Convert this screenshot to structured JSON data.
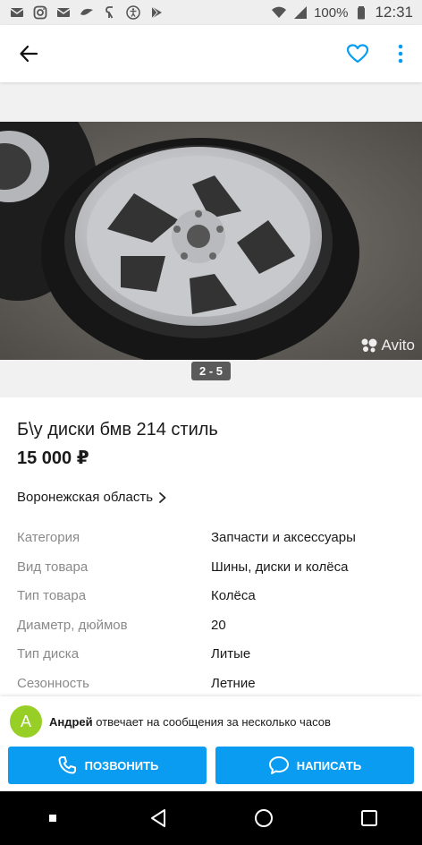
{
  "status_bar": {
    "battery": "100%",
    "time": "12:31",
    "icons": [
      "mail-icon",
      "instagram-icon",
      "mail-icon",
      "messenger-icon",
      "yandex-icon",
      "accessibility-icon",
      "play-store-icon",
      "wifi-icon",
      "signal-icon",
      "battery-icon"
    ]
  },
  "app_bar": {
    "back_icon": "arrow-back-icon",
    "favorite_icon": "heart-outline-icon",
    "more_icon": "more-vertical-icon"
  },
  "gallery": {
    "counter": "2 - 5",
    "watermark": "Avito"
  },
  "ad": {
    "title": "Б\\у диски бмв 214 стиль",
    "price": "15 000 ₽",
    "region": "Воронежская область"
  },
  "params": [
    {
      "name": "Категория",
      "value": "Запчасти и аксессуары"
    },
    {
      "name": "Вид товара",
      "value": "Шины, диски и колёса"
    },
    {
      "name": "Тип товара",
      "value": "Колёса"
    },
    {
      "name": "Диаметр, дюймов",
      "value": "20"
    },
    {
      "name": "Тип диска",
      "value": "Литые"
    },
    {
      "name": "Сезонность",
      "value": "Летние"
    }
  ],
  "contact": {
    "avatar_letter": "А",
    "seller_name": "Андрей",
    "seller_note": " отвечает на сообщения за несколько часов",
    "call_label": "ПОЗВОНИТЬ",
    "write_label": "НАПИСАТЬ"
  },
  "colors": {
    "accent": "#0a9cf0",
    "avatar": "#97cf26",
    "muted": "#8a8a8a"
  }
}
